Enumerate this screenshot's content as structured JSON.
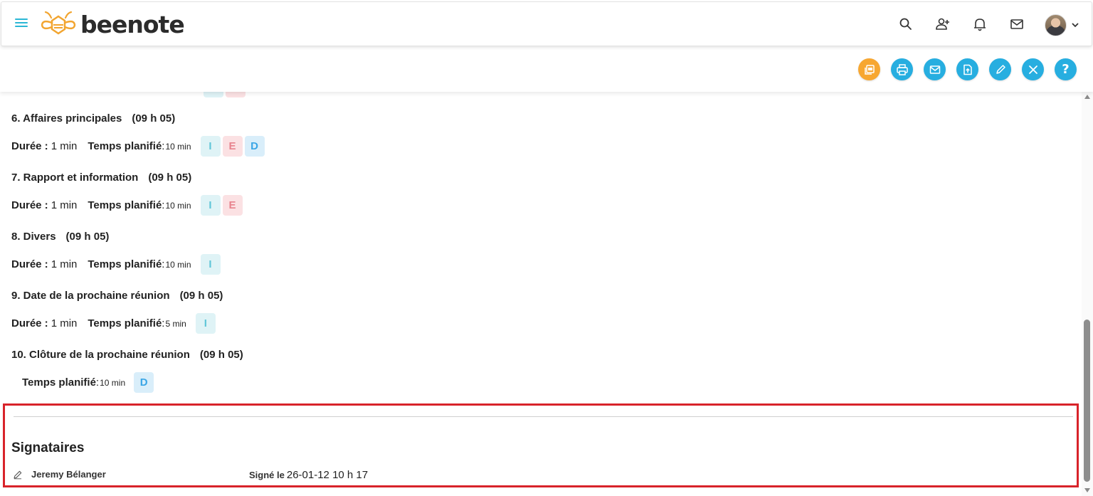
{
  "header": {
    "app_name": "beenote",
    "icons": [
      "menu-icon",
      "search-icon",
      "add-user-icon",
      "bell-icon",
      "mail-icon",
      "avatar",
      "chevron-down-icon"
    ]
  },
  "toolbar": {
    "buttons": [
      {
        "icon": "pdf-icon",
        "color": "#f7a731"
      },
      {
        "icon": "print-icon",
        "color": "#27aee0"
      },
      {
        "icon": "mail-icon",
        "color": "#27aee0"
      },
      {
        "icon": "file-upload-icon",
        "color": "#27aee0"
      },
      {
        "icon": "edit-icon",
        "color": "#27aee0"
      },
      {
        "icon": "close-icon",
        "color": "#27aee0"
      },
      {
        "icon": "help-icon",
        "color": "#27aee0",
        "glyph": "?"
      }
    ]
  },
  "labels": {
    "duration": "Durée :",
    "planned": "Temps planifié",
    "planned_sep": ":"
  },
  "agenda": [
    {
      "title": "6. Affaires principales",
      "time": "(09 h 05)",
      "duration": "1 min",
      "planned": "10 min",
      "chips": [
        "I",
        "E",
        "D"
      ]
    },
    {
      "title": "7. Rapport et information",
      "time": "(09 h 05)",
      "duration": "1 min",
      "planned": "10 min",
      "chips": [
        "I",
        "E"
      ]
    },
    {
      "title": "8. Divers",
      "time": "(09 h 05)",
      "duration": "1 min",
      "planned": "10 min",
      "chips": [
        "I"
      ]
    },
    {
      "title": "9. Date de la prochaine réunion",
      "time": "(09 h 05)",
      "duration": "1 min",
      "planned": "5 min",
      "chips": [
        "I"
      ]
    },
    {
      "title": "10. Clôture de la prochaine réunion",
      "time": "(09 h 05)",
      "duration": "",
      "planned": "10 min",
      "chips": [
        "D"
      ]
    }
  ],
  "colors": {
    "chip_I": "#5fc6d8",
    "chip_E": "#e7838d",
    "chip_D": "#3aa6e6",
    "highlight_border": "#d8232a",
    "accent": "#27aee0"
  },
  "signatories": {
    "heading": "Signataires",
    "rows": [
      {
        "name": "Jeremy Bélanger",
        "signed_label": "Signé le",
        "signed_value": "26-01-12 10 h 17"
      }
    ]
  }
}
